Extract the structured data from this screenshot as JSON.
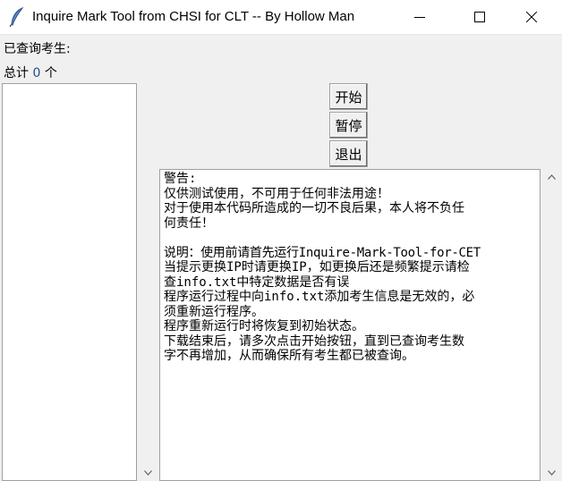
{
  "window": {
    "title": "Inquire Mark Tool from CHSI for CLT -- By Hollow Man",
    "icon": "feather-icon"
  },
  "labels": {
    "queried": "已查询考生:",
    "total_prefix": "总计",
    "total_count": "0",
    "total_suffix": "个"
  },
  "buttons": {
    "start": "开始",
    "pause": "暂停",
    "exit": "退出"
  },
  "log": {
    "lines": [
      "警告:",
      "仅供测试使用，不可用于任何非法用途！",
      "对于使用本代码所造成的一切不良后果，本人将不负任",
      "何责任！",
      "",
      "说明：使用前请首先运行Inquire-Mark-Tool-for-CET",
      "当提示更换IP时请更换IP，如更换后还是频繁提示请检",
      "查info.txt中特定数据是否有误",
      "程序运行过程中向info.txt添加考生信息是无效的，必",
      "须重新运行程序。",
      "程序重新运行时将恢复到初始状态。",
      "下载结束后，请多次点击开始按钮，直到已查询考生数",
      "字不再增加，从而确保所有考生都已被查询。"
    ]
  },
  "colors": {
    "window_bg": "#f0f0f0",
    "count_text": "#1f4d8c"
  }
}
